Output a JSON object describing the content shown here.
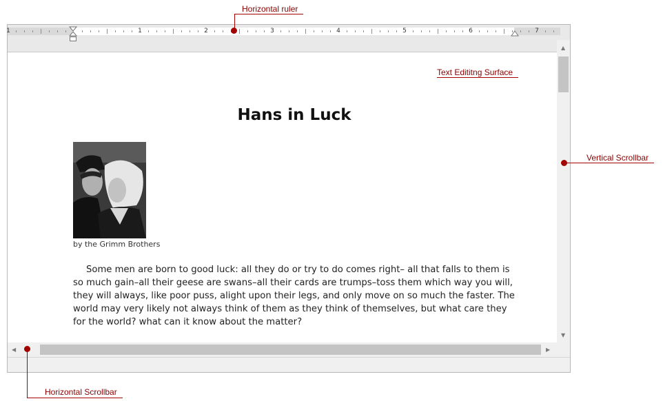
{
  "document": {
    "title": "Hans in Luck",
    "image_caption": "by the Grimm Brothers",
    "paragraph": "Some men are born to good luck: all they do or try to do comes right– all that falls to them is so much gain–all their geese are swans–all their cards are trumps–toss them which way you will, they will always, like poor puss, alight upon their legs, and only move on so much the faster. The world may very likely not always think of them as they think of themselves, but what care they for the world? what can it know about the matter?"
  },
  "ruler": {
    "numbers": [
      "1",
      "1",
      "2",
      "3",
      "4",
      "5",
      "6",
      "7"
    ]
  },
  "callouts": {
    "horizontal_ruler": "Horizontal ruler",
    "text_surface": "Text Edititng Surface",
    "vertical_scrollbar": "Vertical Scrollbar",
    "horizontal_scrollbar": "Horizontal Scrollbar"
  },
  "colors": {
    "callout": "#a30000",
    "page": "#ffffff",
    "chrome": "#f0f0f0"
  },
  "icons": {
    "scroll_up": "triangle-up-icon",
    "scroll_down": "triangle-down-icon",
    "scroll_left": "triangle-left-icon",
    "scroll_right": "triangle-right-icon"
  }
}
